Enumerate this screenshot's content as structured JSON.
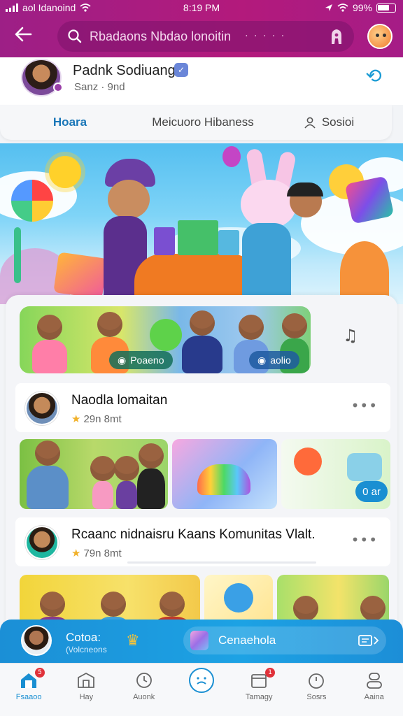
{
  "status_bar": {
    "carrier": "aol Idanoind",
    "time": "8:19 PM",
    "battery": "99%"
  },
  "search": {
    "placeholder": "Rbadaons Nbdao lonoitin",
    "dots": "· · · · ·"
  },
  "profile": {
    "name": "Padnk Sodiuang",
    "meta": "Sanz · 9nd"
  },
  "tabs": [
    {
      "label": "Hoara",
      "active": true
    },
    {
      "label": "Meicuoro Hibaness",
      "active": false
    },
    {
      "label": "Sosioi",
      "active": false
    }
  ],
  "banner": {
    "pills": [
      "Poaeno",
      "aolio"
    ]
  },
  "posts": [
    {
      "title": "Naodla lomaitan",
      "meta": "29n  8mt"
    },
    {
      "title": "Rcaanc nidnaisru Kaans Komunitas Vlalt.",
      "meta": "79n  8mt"
    }
  ],
  "strip1": {
    "chip": "0 ar"
  },
  "player": {
    "title": "Cotoa:",
    "subtitle": "(\\/olcneons",
    "now_playing": "Cenaehola"
  },
  "nav": [
    {
      "label": "Fsaaoo",
      "icon": "home-icon",
      "badge": "5",
      "active": true
    },
    {
      "label": "Hay",
      "icon": "library-icon"
    },
    {
      "label": "Auonk",
      "icon": "clock-icon"
    },
    {
      "label": "",
      "icon": "profile-center-icon"
    },
    {
      "label": "Tamagy",
      "icon": "calendar-icon",
      "badge": "1"
    },
    {
      "label": "Sosrs",
      "icon": "timer-icon"
    },
    {
      "label": "Aaina",
      "icon": "user-icon"
    }
  ],
  "colors": {
    "brand": "#a81b82",
    "accent": "#1a8fd2",
    "player": "#1b8fd6"
  }
}
